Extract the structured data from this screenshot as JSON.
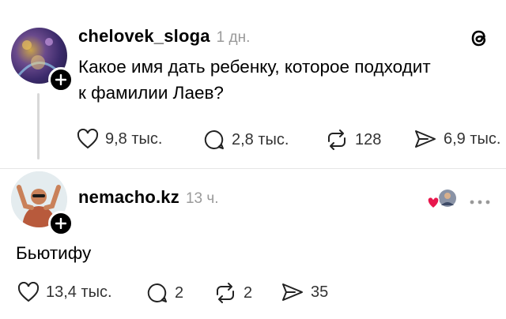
{
  "post1": {
    "username": "chelovek_sloga",
    "time": "1 дн.",
    "text_line1": "Какое имя дать ребенку, которое подходит",
    "text_line2": "к фамилии Лаев?",
    "likes": "9,8 тыс.",
    "replies": "2,8 тыс.",
    "reposts": "128",
    "shares": "6,9 тыс."
  },
  "post2": {
    "username": "nemacho.kz",
    "time": "13 ч.",
    "text": "Бьютифу",
    "likes": "13,4 тыс.",
    "replies": "2",
    "reposts": "2",
    "shares": "35"
  },
  "icons": [
    "threads-logo-icon",
    "heart-icon",
    "comment-icon",
    "repost-icon",
    "share-icon",
    "more-icon",
    "plus-icon",
    "liked-by-author-icon"
  ],
  "colors": {
    "text": "#000000",
    "muted": "#9a9a9a",
    "like": "#e8174d",
    "divider": "#e6e6e6"
  }
}
